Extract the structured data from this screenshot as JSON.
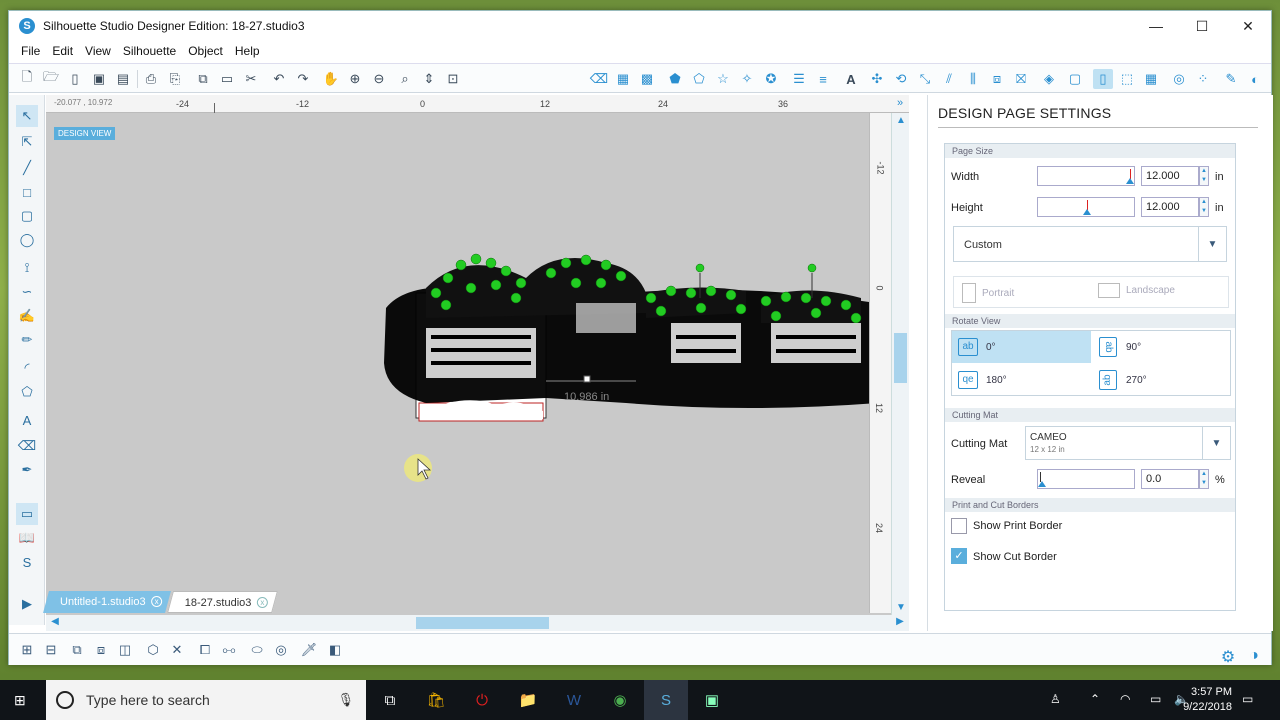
{
  "window": {
    "title": "Silhouette Studio Designer Edition: 18-27.studio3",
    "controls": {
      "minimize": "—",
      "maximize": "☐",
      "close": "✕"
    }
  },
  "menu": [
    "File",
    "Edit",
    "View",
    "Silhouette",
    "Object",
    "Help"
  ],
  "canvas": {
    "coords": "-20.077 , 10.972",
    "design_view_label": "DESIGN VIEW",
    "ruler_ticks": [
      "-24",
      "-12",
      "0",
      "12",
      "24",
      "36"
    ],
    "ruler_right_ticks": [
      "-12",
      "0",
      "12",
      "24"
    ],
    "dimension_label": "10.986 in"
  },
  "doc_tabs": [
    {
      "label": "Untitled-1.studio3",
      "close": "x"
    },
    {
      "label": "18-27.studio3",
      "close": "x"
    }
  ],
  "panel": {
    "title": "DESIGN PAGE SETTINGS",
    "page_size": {
      "section": "Page Size",
      "width_label": "Width",
      "width_value": "12.000",
      "width_unit": "in",
      "height_label": "Height",
      "height_value": "12.000",
      "height_unit": "in",
      "preset": "Custom",
      "portrait_label": "Portrait",
      "landscape_label": "Landscape"
    },
    "rotate_view": {
      "section": "Rotate View",
      "options": [
        {
          "icon": "ab",
          "label": "0°"
        },
        {
          "icon": "ab",
          "label": "90°"
        },
        {
          "icon": "qe",
          "label": "180°"
        },
        {
          "icon": "ab",
          "label": "270°"
        }
      ]
    },
    "cutting_mat": {
      "section": "Cutting Mat",
      "label": "Cutting Mat",
      "value": "CAMEO",
      "sub": "12 x 12 in",
      "reveal_label": "Reveal",
      "reveal_value": "0.0",
      "reveal_unit": "%"
    },
    "borders": {
      "section": "Print and Cut Borders",
      "print_label": "Show Print Border",
      "print_checked": false,
      "cut_label": "Show Cut Border",
      "cut_checked": true
    }
  },
  "taskbar": {
    "search_placeholder": "Type here to search",
    "time": "3:57 PM",
    "date": "9/22/2018"
  },
  "colors": {
    "accent": "#2a8fd0",
    "selection_handle": "#22cc22",
    "tab_inactive": "#7fc1e6"
  }
}
